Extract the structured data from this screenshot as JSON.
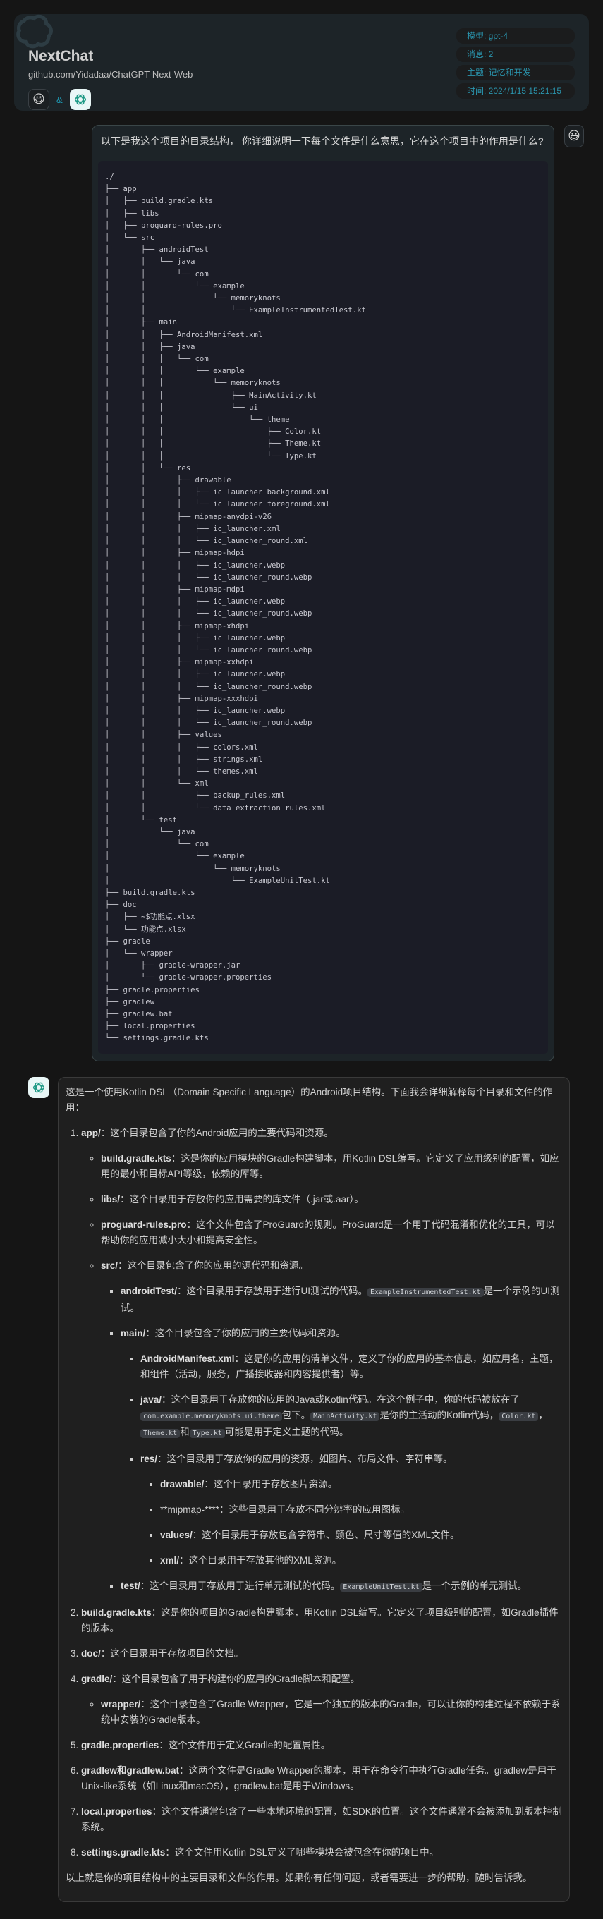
{
  "header": {
    "title": "NextChat",
    "subtitle": "github.com/Yidadaa/ChatGPT-Next-Web",
    "user_avatar": "😃",
    "amp": "&",
    "bot_avatar_icon": "openai-logo-icon",
    "meta": [
      "模型: gpt-4",
      "消息: 2",
      "主题: 记忆和开发",
      "时间: 2024/1/15 15:21:15"
    ]
  },
  "colors": {
    "accent": "#2a94ad",
    "header_bg": "#1d2428",
    "page_bg": "#151515",
    "code_bg": "#1b1c26"
  },
  "user_message": {
    "avatar": "😃",
    "question": "以下是我这个项目的目录结构， 你详细说明一下每个文件是什么意思，它在这个项目中的作用是什么?",
    "code": "./\n├── app\n│   ├── build.gradle.kts\n│   ├── libs\n│   ├── proguard-rules.pro\n│   └── src\n│       ├── androidTest\n│       │   └── java\n│       │       └── com\n│       │           └── example\n│       │               └── memoryknots\n│       │                   └── ExampleInstrumentedTest.kt\n│       ├── main\n│       │   ├── AndroidManifest.xml\n│       │   ├── java\n│       │   │   └── com\n│       │   │       └── example\n│       │   │           └── memoryknots\n│       │   │               ├── MainActivity.kt\n│       │   │               └── ui\n│       │   │                   └── theme\n│       │   │                       ├── Color.kt\n│       │   │                       ├── Theme.kt\n│       │   │                       └── Type.kt\n│       │   └── res\n│       │       ├── drawable\n│       │       │   ├── ic_launcher_background.xml\n│       │       │   └── ic_launcher_foreground.xml\n│       │       ├── mipmap-anydpi-v26\n│       │       │   ├── ic_launcher.xml\n│       │       │   └── ic_launcher_round.xml\n│       │       ├── mipmap-hdpi\n│       │       │   ├── ic_launcher.webp\n│       │       │   └── ic_launcher_round.webp\n│       │       ├── mipmap-mdpi\n│       │       │   ├── ic_launcher.webp\n│       │       │   └── ic_launcher_round.webp\n│       │       ├── mipmap-xhdpi\n│       │       │   ├── ic_launcher.webp\n│       │       │   └── ic_launcher_round.webp\n│       │       ├── mipmap-xxhdpi\n│       │       │   ├── ic_launcher.webp\n│       │       │   └── ic_launcher_round.webp\n│       │       ├── mipmap-xxxhdpi\n│       │       │   ├── ic_launcher.webp\n│       │       │   └── ic_launcher_round.webp\n│       │       ├── values\n│       │       │   ├── colors.xml\n│       │       │   ├── strings.xml\n│       │       │   └── themes.xml\n│       │       └── xml\n│       │           ├── backup_rules.xml\n│       │           └── data_extraction_rules.xml\n│       └── test\n│           └── java\n│               └── com\n│                   └── example\n│                       └── memoryknots\n│                           └── ExampleUnitTest.kt\n├── build.gradle.kts\n├── doc\n│   ├── ~$功能点.xlsx\n│   └── 功能点.xlsx\n├── gradle\n│   └── wrapper\n│       ├── gradle-wrapper.jar\n│       └── gradle-wrapper.properties\n├── gradle.properties\n├── gradlew\n├── gradlew.bat\n├── local.properties\n└── settings.gradle.kts"
  },
  "bot_message": {
    "avatar_icon": "openai-logo-icon",
    "intro": "这是一个使用Kotlin DSL（Domain Specific Language）的Android项目结构。下面我会详细解释每个目录和文件的作用：",
    "items": [
      {
        "name": "app/",
        "text": "：这个目录包含了你的Android应用的主要代码和资源。"
      },
      {
        "name": "build.gradle.kts",
        "text": "：这是你的项目的Gradle构建脚本，用Kotlin DSL编写。它定义了项目级别的配置，如Gradle插件的版本。"
      },
      {
        "name": "doc/",
        "text": "：这个目录用于存放项目的文档。"
      },
      {
        "name": "gradle/",
        "text": "：这个目录包含了用于构建你的应用的Gradle脚本和配置。"
      },
      {
        "name": "gradle.properties",
        "text": "：这个文件用于定义Gradle的配置属性。"
      },
      {
        "name": "gradlew和gradlew.bat",
        "text": "：这两个文件是Gradle Wrapper的脚本，用于在命令行中执行Gradle任务。gradlew是用于Unix-like系统（如Linux和macOS），gradlew.bat是用于Windows。"
      },
      {
        "name": "local.properties",
        "text": "：这个文件通常包含了一些本地环境的配置，如SDK的位置。这个文件通常不会被添加到版本控制系统。"
      },
      {
        "name": "settings.gradle.kts",
        "text": "：这个文件用Kotlin DSL定义了哪些模块会被包含在你的项目中。"
      }
    ],
    "app_sub": [
      {
        "name": "build.gradle.kts",
        "text": "：这是你的应用模块的Gradle构建脚本，用Kotlin DSL编写。它定义了应用级别的配置，如应用的最小和目标API等级，依赖的库等。"
      },
      {
        "name": "libs/",
        "text": "：这个目录用于存放你的应用需要的库文件（.jar或.aar）。"
      },
      {
        "name": "proguard-rules.pro",
        "text": "：这个文件包含了ProGuard的规则。ProGuard是一个用于代码混淆和优化的工具，可以帮助你的应用减小大小和提高安全性。"
      },
      {
        "name": "src/",
        "text": "：这个目录包含了你的应用的源代码和资源。"
      }
    ],
    "src_sub": {
      "androidTest": {
        "name": "androidTest/",
        "text": "：这个目录用于存放用于进行UI测试的代码。",
        "code": "ExampleInstrumentedTest.kt",
        "after": "是一个示例的UI测试。"
      },
      "main": {
        "name": "main/",
        "text": "：这个目录包含了你的应用的主要代码和资源。"
      },
      "test": {
        "name": "test/",
        "text": "：这个目录用于存放用于进行单元测试的代码。",
        "code": "ExampleUnitTest.kt",
        "after": "是一个示例的单元测试。"
      }
    },
    "main_sub": {
      "manifest": {
        "name": "AndroidManifest.xml",
        "text": "：这是你的应用的清单文件，定义了你的应用的基本信息，如应用名，主题，和组件（活动，服务，广播接收器和内容提供者）等。"
      },
      "java": {
        "name": "java/",
        "text": "：这个目录用于存放你的应用的Java或Kotlin代码。在这个例子中，你的代码被放在了",
        "code1": "com.example.memoryknots.ui.theme",
        "t2": "包下。",
        "code2": "MainActivity.kt",
        "t3": "是你的主活动的Kotlin代码，",
        "code3": "Color.kt",
        "t4": "，",
        "code4": "Theme.kt",
        "t5": "和",
        "code5": "Type.kt",
        "t6": "可能是用于定义主题的代码。"
      },
      "res": {
        "name": "res/",
        "text": "：这个目录用于存放你的应用的资源，如图片、布局文件、字符串等。"
      }
    },
    "res_sub": [
      {
        "name": "drawable/",
        "text": "：这个目录用于存放图片资源。",
        "bold": true
      },
      {
        "name": "**mipmap-****",
        "text": "：这些目录用于存放不同分辨率的应用图标。",
        "bold": false
      },
      {
        "name": "values/",
        "text": "：这个目录用于存放包含字符串、颜色、尺寸等值的XML文件。",
        "bold": true
      },
      {
        "name": "xml/",
        "text": "：这个目录用于存放其他的XML资源。",
        "bold": true
      }
    ],
    "gradle_sub": [
      {
        "name": "wrapper/",
        "text": "：这个目录包含了Gradle Wrapper，它是一个独立的版本的Gradle，可以让你的构建过程不依赖于系统中安装的Gradle版本。"
      }
    ],
    "outro": "以上就是你的项目结构中的主要目录和文件的作用。如果你有任何问题，或者需要进一步的帮助，随时告诉我。"
  }
}
